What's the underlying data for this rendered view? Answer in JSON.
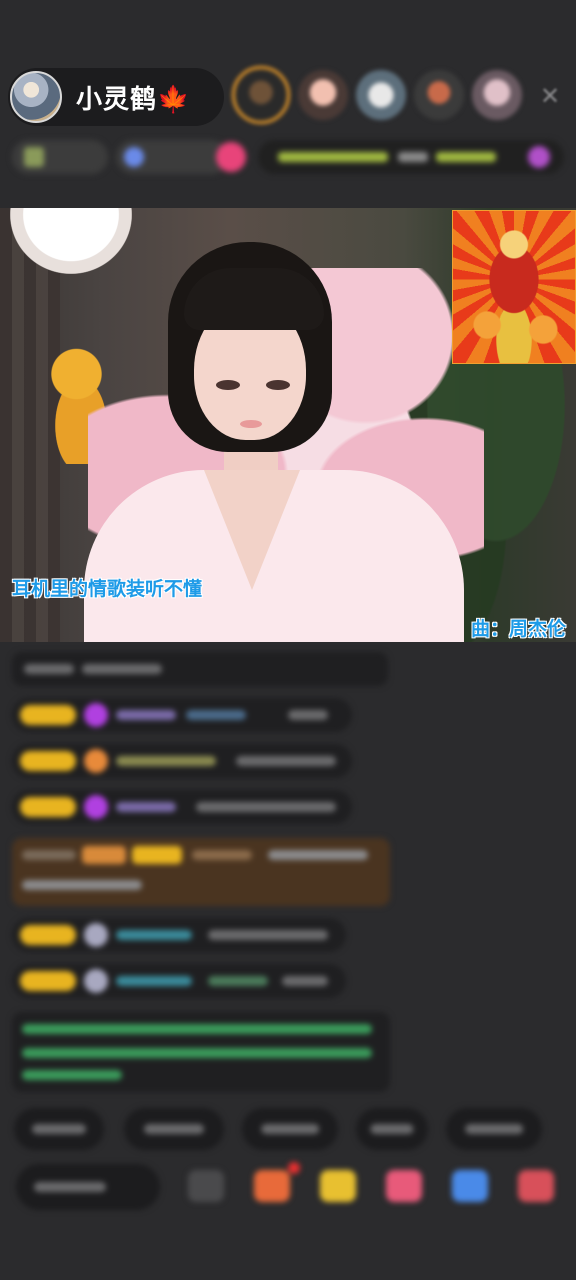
{
  "header": {
    "host_name": "小灵鹤",
    "host_badge_emoji": "🍁",
    "close_label": "✕"
  },
  "viewers_count_visible": 5,
  "video": {
    "lyric": "耳机里的情歌装听不懂",
    "song_credit": "曲：周杰伦"
  },
  "colors": {
    "background": "#2b2b2d",
    "lyric_text": "#1e9be8",
    "badge_gold": "#e8b420",
    "highlight_msg": "#4a3420"
  },
  "icons": {
    "close": "close-icon",
    "gift": "gift-icon",
    "more": "more-icon"
  }
}
